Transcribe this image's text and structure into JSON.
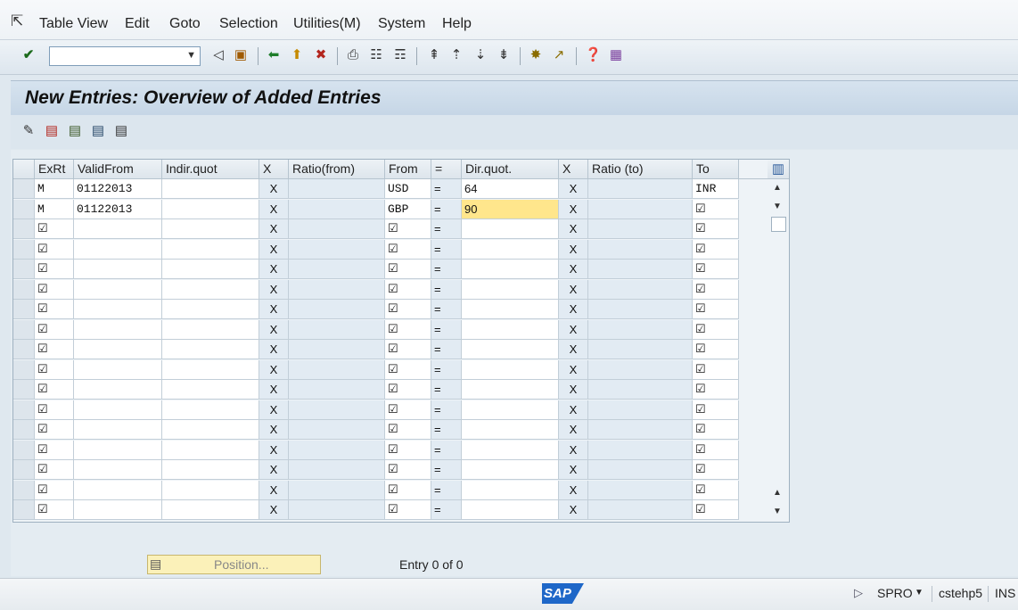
{
  "menubar": {
    "items": [
      "Table View",
      "Edit",
      "Goto",
      "Selection",
      "Utilities(M)",
      "System",
      "Help"
    ]
  },
  "toolbar": {
    "command_value": ""
  },
  "title": "New Entries: Overview of Added Entries",
  "table": {
    "headers": [
      "ExRt",
      "ValidFrom",
      "Indir.quot",
      "X",
      "Ratio(from)",
      "From",
      "=",
      "Dir.quot.",
      "X",
      "Ratio (to)",
      "To"
    ],
    "rows": [
      {
        "exrt": "M",
        "valid": "01122013",
        "indir": "",
        "x1": "X",
        "rfrom": "",
        "from": "USD",
        "eq": "=",
        "dir": "64",
        "x2": "X",
        "rto": "",
        "to": "INR"
      },
      {
        "exrt": "M",
        "valid": "01122013",
        "indir": "",
        "x1": "X",
        "rfrom": "",
        "from": "GBP",
        "eq": "=",
        "dir": "90",
        "x2": "X",
        "rto": "",
        "to": "☑"
      },
      {
        "exrt": "☑",
        "valid": "",
        "indir": "",
        "x1": "X",
        "rfrom": "",
        "from": "☑",
        "eq": "=",
        "dir": "",
        "x2": "X",
        "rto": "",
        "to": "☑"
      },
      {
        "exrt": "☑",
        "valid": "",
        "indir": "",
        "x1": "X",
        "rfrom": "",
        "from": "☑",
        "eq": "=",
        "dir": "",
        "x2": "X",
        "rto": "",
        "to": "☑"
      },
      {
        "exrt": "☑",
        "valid": "",
        "indir": "",
        "x1": "X",
        "rfrom": "",
        "from": "☑",
        "eq": "=",
        "dir": "",
        "x2": "X",
        "rto": "",
        "to": "☑"
      },
      {
        "exrt": "☑",
        "valid": "",
        "indir": "",
        "x1": "X",
        "rfrom": "",
        "from": "☑",
        "eq": "=",
        "dir": "",
        "x2": "X",
        "rto": "",
        "to": "☑"
      },
      {
        "exrt": "☑",
        "valid": "",
        "indir": "",
        "x1": "X",
        "rfrom": "",
        "from": "☑",
        "eq": "=",
        "dir": "",
        "x2": "X",
        "rto": "",
        "to": "☑"
      },
      {
        "exrt": "☑",
        "valid": "",
        "indir": "",
        "x1": "X",
        "rfrom": "",
        "from": "☑",
        "eq": "=",
        "dir": "",
        "x2": "X",
        "rto": "",
        "to": "☑"
      },
      {
        "exrt": "☑",
        "valid": "",
        "indir": "",
        "x1": "X",
        "rfrom": "",
        "from": "☑",
        "eq": "=",
        "dir": "",
        "x2": "X",
        "rto": "",
        "to": "☑"
      },
      {
        "exrt": "☑",
        "valid": "",
        "indir": "",
        "x1": "X",
        "rfrom": "",
        "from": "☑",
        "eq": "=",
        "dir": "",
        "x2": "X",
        "rto": "",
        "to": "☑"
      },
      {
        "exrt": "☑",
        "valid": "",
        "indir": "",
        "x1": "X",
        "rfrom": "",
        "from": "☑",
        "eq": "=",
        "dir": "",
        "x2": "X",
        "rto": "",
        "to": "☑"
      },
      {
        "exrt": "☑",
        "valid": "",
        "indir": "",
        "x1": "X",
        "rfrom": "",
        "from": "☑",
        "eq": "=",
        "dir": "",
        "x2": "X",
        "rto": "",
        "to": "☑"
      },
      {
        "exrt": "☑",
        "valid": "",
        "indir": "",
        "x1": "X",
        "rfrom": "",
        "from": "☑",
        "eq": "=",
        "dir": "",
        "x2": "X",
        "rto": "",
        "to": "☑"
      },
      {
        "exrt": "☑",
        "valid": "",
        "indir": "",
        "x1": "X",
        "rfrom": "",
        "from": "☑",
        "eq": "=",
        "dir": "",
        "x2": "X",
        "rto": "",
        "to": "☑"
      },
      {
        "exrt": "☑",
        "valid": "",
        "indir": "",
        "x1": "X",
        "rfrom": "",
        "from": "☑",
        "eq": "=",
        "dir": "",
        "x2": "X",
        "rto": "",
        "to": "☑"
      },
      {
        "exrt": "☑",
        "valid": "",
        "indir": "",
        "x1": "X",
        "rfrom": "",
        "from": "☑",
        "eq": "=",
        "dir": "",
        "x2": "X",
        "rto": "",
        "to": "☑"
      },
      {
        "exrt": "☑",
        "valid": "",
        "indir": "",
        "x1": "X",
        "rfrom": "",
        "from": "☑",
        "eq": "=",
        "dir": "",
        "x2": "X",
        "rto": "",
        "to": "☑"
      }
    ]
  },
  "footer": {
    "position_button": "Position...",
    "entry_text": "Entry 0 of 0"
  },
  "statusbar": {
    "logo": "SAP",
    "transaction": "SPRO",
    "server": "cstehp5",
    "mode": "INS"
  }
}
